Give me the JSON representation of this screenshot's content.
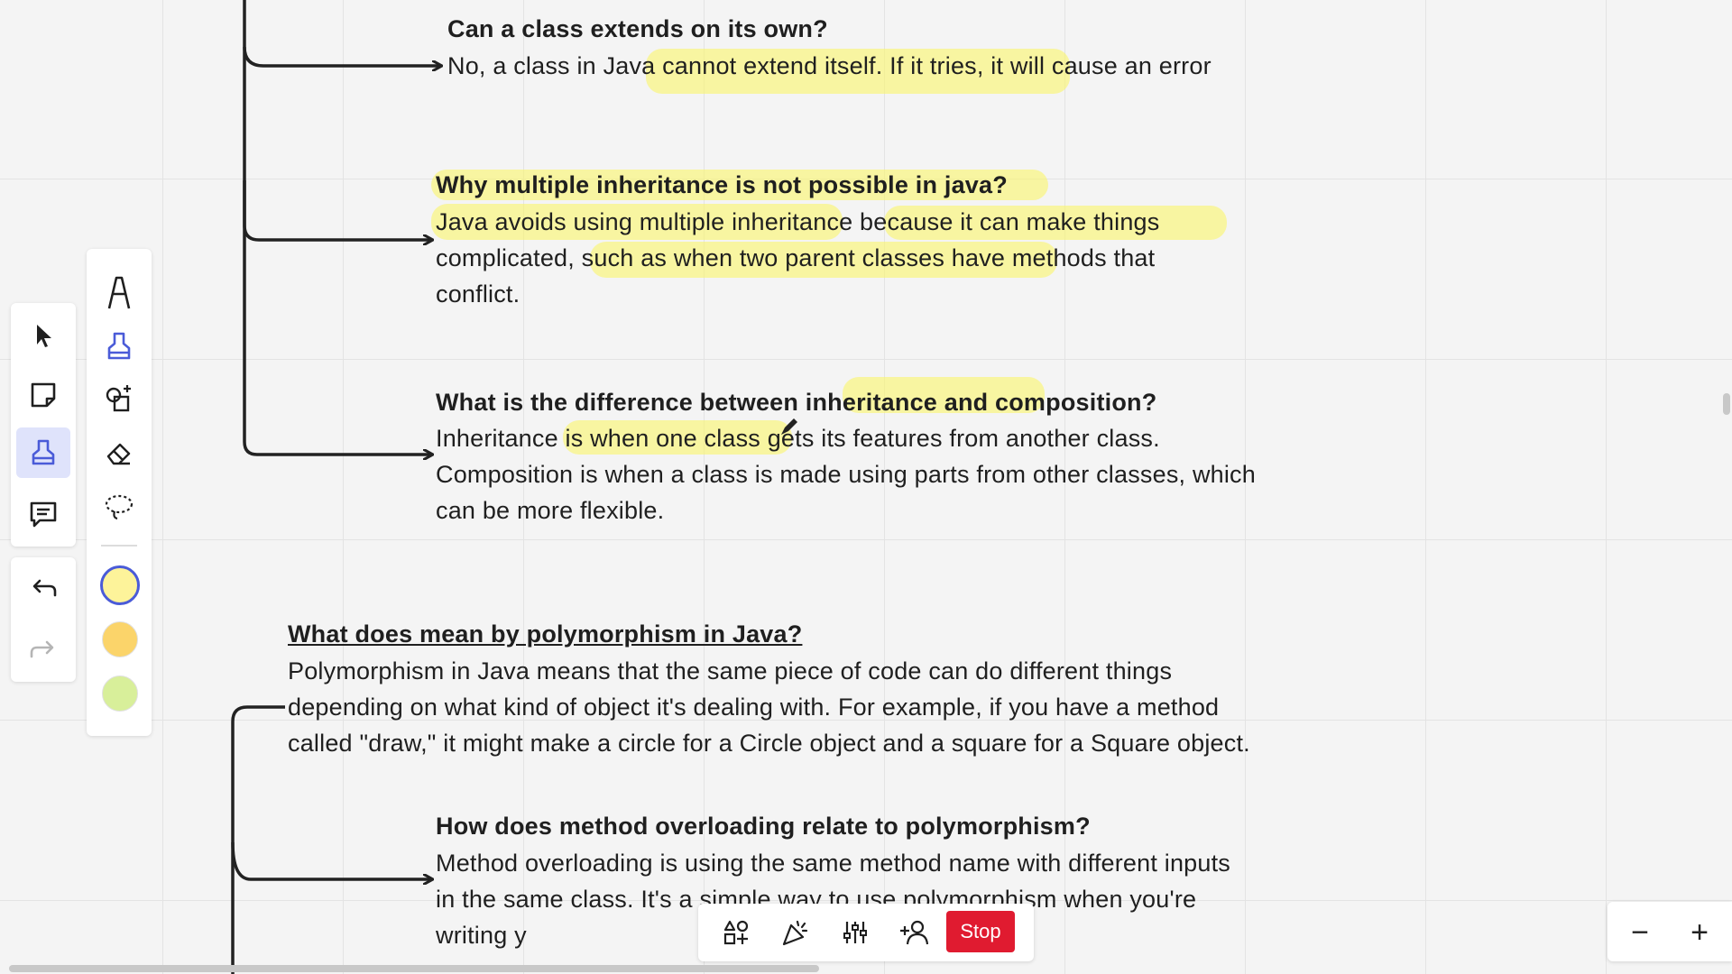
{
  "board": {
    "q1": {
      "title": "Can a class extends on its own?",
      "answer": "No, a class in Java cannot extend itself. If it tries, it will cause an error"
    },
    "q2": {
      "title": "Why multiple inheritance is not possible in java?",
      "answer": "Java avoids using multiple inheritance because it can make things complicated, such as when two parent classes have methods that conflict."
    },
    "q3": {
      "title": "What is the difference between inheritance and composition?",
      "answer": "Inheritance is when one class gets its features from another class. Composition is when a class is made using parts from other classes, which can be more flexible."
    },
    "poly": {
      "title": "What does mean by polymorphism in Java?",
      "answer": "Polymorphism in Java means that the same piece of code can do different things depending on what kind of object it's dealing with. For example, if you have a method called \"draw,\" it might make a circle for a Circle object and a square for a Square object."
    },
    "q4": {
      "title": "How does method overloading relate to polymorphism?",
      "answer": "Method overloading is using the same method name with different inputs in the same class. It's a simple way to use polymorphism when you're  writing y"
    }
  },
  "toolbar": {
    "tools": [
      "select-tool",
      "sticky-note-tool",
      "pen-tool",
      "comment-tool"
    ],
    "undo": "undo",
    "redo": "redo"
  },
  "pen_panel": {
    "tools": [
      "pen",
      "highlighter",
      "shape-recognition",
      "eraser",
      "lasso"
    ],
    "colors": [
      "#fdf39a",
      "#fbd46a",
      "#d8ef9a"
    ],
    "selected_color_index": 0,
    "highlight_color": "#faf56e"
  },
  "bottom_bar": {
    "stop_label": "Stop"
  },
  "zoom": {
    "minus": "−",
    "plus": "+"
  }
}
